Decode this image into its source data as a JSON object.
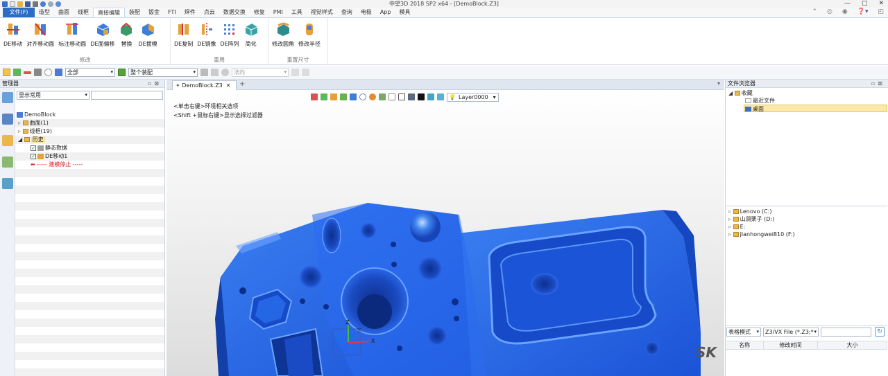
{
  "window": {
    "title": "中望3D 2018 SP2 x64 - [DemoBlock.Z3]",
    "controls": [
      "—",
      "□",
      "✕"
    ]
  },
  "menubar": {
    "file_label": "文件(F)",
    "tabs": [
      "造型",
      "曲面",
      "线框",
      "直接编辑",
      "装配",
      "钣金",
      "FTI",
      "焊件",
      "点云",
      "数据交换",
      "修复",
      "PMI",
      "工具",
      "视觉样式",
      "查询",
      "电极",
      "App",
      "模具"
    ],
    "active_tab": "直接编辑"
  },
  "ribbon": {
    "groups": [
      {
        "label": "修改",
        "buttons": [
          "DE移动",
          "对齐移动面",
          "标注移动面",
          "DE面偏移",
          "替换",
          "DE拔模"
        ]
      },
      {
        "label": "重用",
        "buttons": [
          "DE复制",
          "DE镜像",
          "DE阵列",
          "简化"
        ]
      },
      {
        "label": "重置尺寸",
        "buttons": [
          "修改圆角",
          "修改半径"
        ]
      }
    ]
  },
  "toolbar2": {
    "filter_value": "全部",
    "assembly_value": "整个装配",
    "direction_placeholder": "法向"
  },
  "manager": {
    "title": "管理器",
    "filter_value": "显示常用",
    "tree": [
      {
        "label": "DemoBlock",
        "level": 0
      },
      {
        "label": "曲面(1)",
        "level": 1
      },
      {
        "label": "线框(19)",
        "level": 1
      },
      {
        "label": "历史",
        "level": 1
      },
      {
        "label": "静态数据",
        "level": 2
      },
      {
        "label": "DE移动1",
        "level": 2
      },
      {
        "label": "----- 建模停止 -----",
        "level": 2
      }
    ]
  },
  "viewport": {
    "doc_tab": "DemoBlock.Z3",
    "hint1": "<单击右键>环境相关选项",
    "hint2": "<Shift +鼠标右键>显示选择过滤器",
    "layer": "Layer0000",
    "watermark": "SK",
    "axis_labels": [
      "Z",
      "Y",
      "X"
    ],
    "model_color": "#1f5fe0"
  },
  "file_browser": {
    "title": "文件浏览器",
    "favorites": [
      "收藏",
      "最近文件",
      "桌面"
    ],
    "drives": [
      "Lenovo (C:)",
      "山涧栗子 (D:)",
      "E:",
      "Jianhongwei810 (F:)"
    ],
    "view_mode": "表格模式",
    "file_type": "Z3/VX File (*.Z3;*",
    "columns": [
      "名称",
      "修改时间",
      "大小"
    ]
  }
}
